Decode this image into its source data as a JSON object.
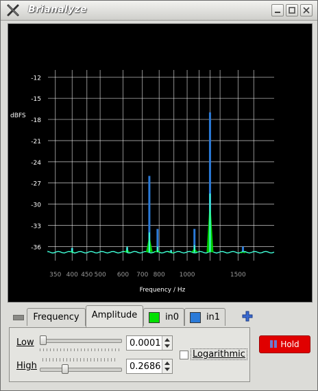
{
  "window": {
    "title": "Brianalyze"
  },
  "plot": {
    "ylabel": "dBFS",
    "xlabel": "Frequency / Hz",
    "yticks": [
      "-12",
      "-15",
      "-18",
      "-21",
      "-24",
      "-27",
      "-30",
      "-33",
      "-36"
    ],
    "xticks": [
      "350",
      "400",
      "450",
      "500",
      "600",
      "700",
      "800",
      "1000",
      "1500"
    ],
    "colors": {
      "background": "#000000",
      "grid": "#ffffff",
      "in0": "#00e000",
      "in1": "#2a7ad8",
      "overlap": "#40ffd8"
    }
  },
  "chart_data": {
    "type": "line",
    "title": "",
    "xlabel": "Frequency / Hz",
    "ylabel": "dBFS",
    "x_scale": "log",
    "xlim": [
      330,
      2000
    ],
    "ylim": [
      -38,
      -11
    ],
    "series": [
      {
        "name": "in0",
        "x": [
          400,
          620,
          740,
          790,
          880,
          1060,
          1200,
          1560
        ],
        "values": [
          -36.2,
          -36.0,
          -34.0,
          -36.0,
          -36.5,
          -35.8,
          -28.5,
          -36.6
        ]
      },
      {
        "name": "in1",
        "x": [
          400,
          620,
          740,
          790,
          880,
          1060,
          1200,
          1560
        ],
        "values": [
          -36.2,
          -36.2,
          -26.0,
          -33.5,
          -36.5,
          -33.5,
          -17.0,
          -36.0
        ]
      }
    ]
  },
  "tabs": {
    "frequency": "Frequency",
    "amplitude": "Amplitude",
    "in0": "in0",
    "in1": "in1"
  },
  "amplitude": {
    "low_label": "Low",
    "high_label": "High",
    "low_value": "0.0001",
    "high_value": "0.2686",
    "log_label": "Logarithmic",
    "low_slider_level": 0.0,
    "high_slider_level": 0.3
  },
  "hold": {
    "label": "Hold",
    "color": "#e00000"
  }
}
